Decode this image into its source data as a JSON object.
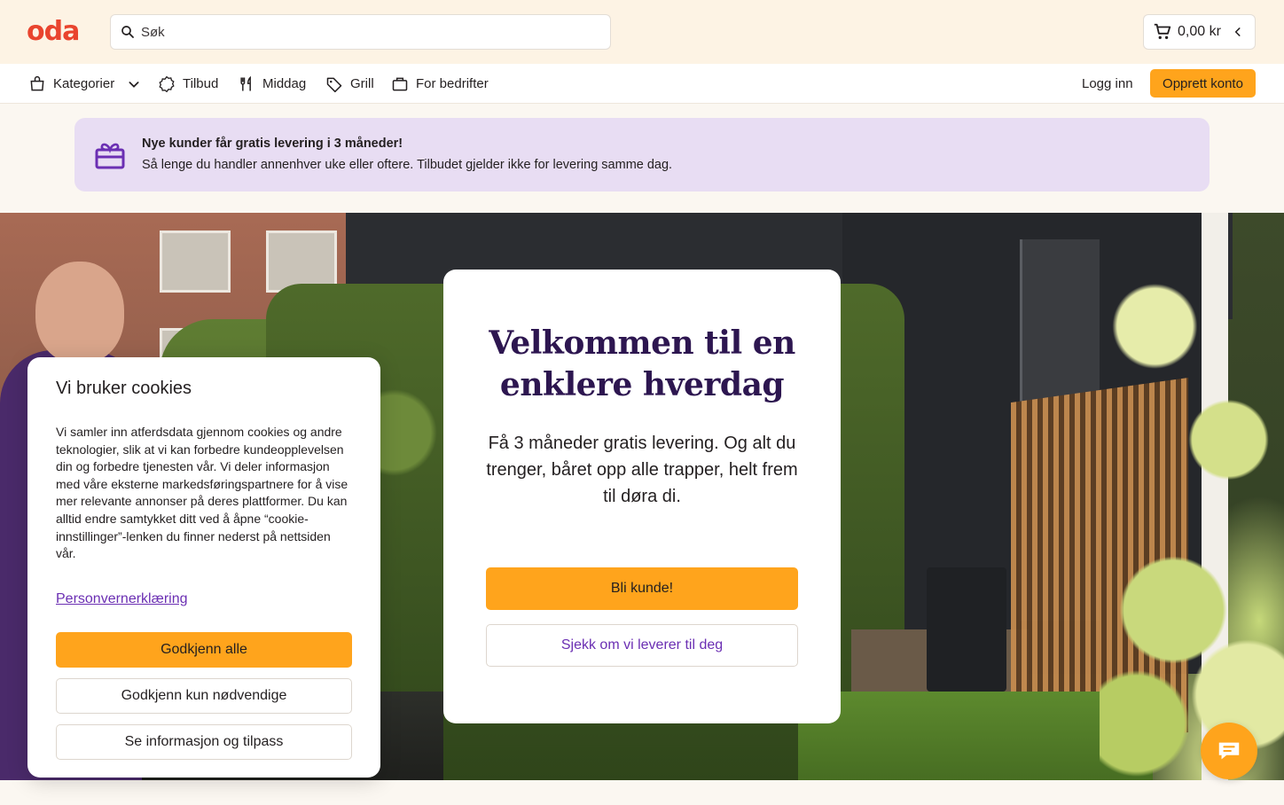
{
  "brand": {
    "logo_text": "oda",
    "accent": "#ffa41c",
    "logo_color": "#e9442e",
    "purple": "#2d1650"
  },
  "search": {
    "placeholder": "Søk"
  },
  "cart": {
    "total": "0,00 kr"
  },
  "nav": {
    "items": [
      {
        "label": "Kategorier",
        "icon": "bag-icon"
      },
      {
        "label": "Tilbud",
        "icon": "badge-icon"
      },
      {
        "label": "Middag",
        "icon": "cutlery-icon"
      },
      {
        "label": "Grill",
        "icon": "tag-icon"
      },
      {
        "label": "For bedrifter",
        "icon": "briefcase-icon"
      }
    ],
    "login_label": "Logg inn",
    "signup_label": "Opprett konto"
  },
  "promo": {
    "title": "Nye kunder får gratis levering i 3 måneder!",
    "text": "Så lenge du handler annenhver uke eller oftere. Tilbudet gjelder ikke for levering samme dag."
  },
  "welcome": {
    "title_line1": "Velkommen til en",
    "title_line2": "enklere hverdag",
    "text": "Få 3 måneder gratis levering. Og alt du trenger, båret opp alle trapper, helt frem til døra di.",
    "primary_label": "Bli kunde!",
    "secondary_label": "Sjekk om vi leverer til deg"
  },
  "cookie": {
    "title": "Vi bruker cookies",
    "text": "Vi samler inn atferdsdata gjennom cookies og andre teknologier, slik at vi kan forbedre kundeopplevelsen din og forbedre tjenesten vår. Vi deler informasjon med våre eksterne markedsføringspartnere for å vise mer relevante annonser på deres plattformer. Du kan alltid endre samtykket ditt ved å åpne “cookie-innstillinger”-lenken du finner nederst på nettsiden vår.",
    "privacy_link": "Personvernerklæring",
    "accept_all": "Godkjenn alle",
    "accept_necessary": "Godkjenn kun nødvendige",
    "customize": "Se informasjon og tilpass"
  }
}
